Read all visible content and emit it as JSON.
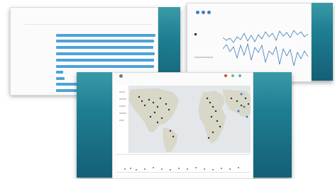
{
  "left_window": {
    "header_title": "",
    "header_small": ""
  },
  "right_window": {
    "legend_label": ""
  },
  "bottom_window": {
    "map_label": ""
  },
  "colors": {
    "panel_top": "#3a9aa7",
    "panel_bottom": "#145f76",
    "bar_blue": "#4da3d9",
    "line_blue": "#3d7bbd"
  }
}
